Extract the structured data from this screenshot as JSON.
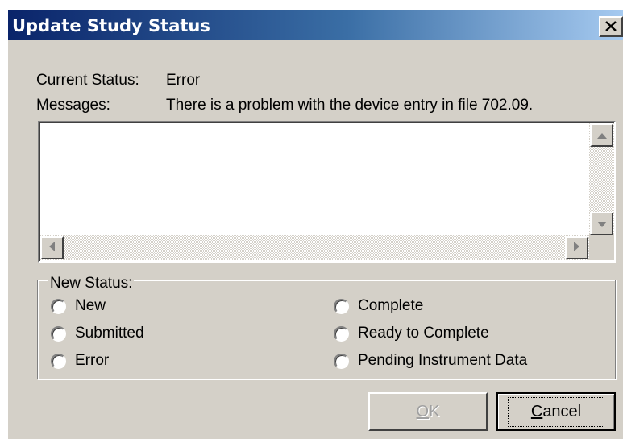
{
  "window": {
    "title": "Update Study Status",
    "close_glyph": "✕"
  },
  "info": {
    "current_status_label": "Current Status:",
    "current_status_value": "Error",
    "messages_label": "Messages:",
    "messages_value": "There is a problem with the device entry in file 702.09."
  },
  "message_box": {
    "text": ""
  },
  "new_status": {
    "group_label": "New Status:",
    "options": [
      {
        "label": "New",
        "selected": false
      },
      {
        "label": "Submitted",
        "selected": false
      },
      {
        "label": "Error",
        "selected": false
      },
      {
        "label": "Complete",
        "selected": false
      },
      {
        "label": "Ready to Complete",
        "selected": false
      },
      {
        "label": "Pending Instrument Data",
        "selected": false
      }
    ]
  },
  "buttons": {
    "ok_mnemonic": "O",
    "ok_rest": "K",
    "ok_enabled": false,
    "cancel_mnemonic": "C",
    "cancel_rest": "ancel"
  }
}
